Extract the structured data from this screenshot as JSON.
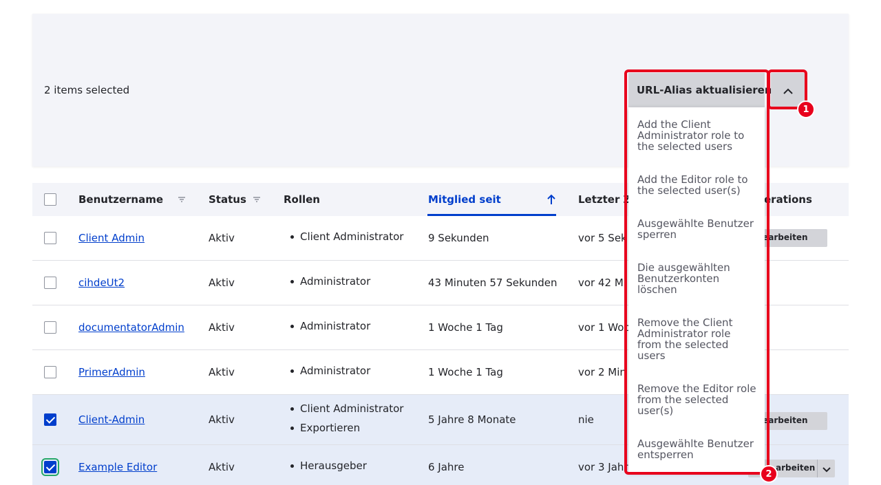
{
  "bulk": {
    "selected_count": "2 items selected",
    "action_label": "URL-Alias aktualisieren"
  },
  "table": {
    "headers": {
      "username": "Benutzername",
      "status": "Status",
      "roles": "Rollen",
      "member_since": "Mitglied seit",
      "last_access": "Letzter Z",
      "operations": "erations"
    },
    "rows": [
      {
        "username": "Client Admin",
        "status": "Aktiv",
        "roles": [
          "Client Administrator"
        ],
        "member_since": "9 Sekunden",
        "last_access": "vor 5 Sek",
        "operation": "Bearbeiten",
        "checked": false
      },
      {
        "username": "cihdeUt2",
        "status": "Aktiv",
        "roles": [
          "Administrator"
        ],
        "member_since": "43 Minuten 57 Sekunden",
        "last_access": "vor 42 Mi",
        "operation": "",
        "checked": false
      },
      {
        "username": "documentatorAdmin",
        "status": "Aktiv",
        "roles": [
          "Administrator"
        ],
        "member_since": "1 Woche 1 Tag",
        "last_access": "vor 1 Woc",
        "operation": "",
        "checked": false
      },
      {
        "username": "PrimerAdmin",
        "status": "Aktiv",
        "roles": [
          "Administrator"
        ],
        "member_since": "1 Woche 1 Tag",
        "last_access": "vor 2 Min",
        "operation": "",
        "checked": false
      },
      {
        "username": "Client-Admin",
        "status": "Aktiv",
        "roles": [
          "Client Administrator",
          "Exportieren"
        ],
        "member_since": "5 Jahre 8 Monate",
        "last_access": "nie",
        "operation": "Bearbeiten",
        "checked": true
      },
      {
        "username": "Example Editor",
        "status": "Aktiv",
        "roles": [
          "Herausgeber"
        ],
        "member_since": "6 Jahre",
        "last_access": "vor 3 Jahr",
        "operation": "arbeiten",
        "checked": true
      }
    ]
  },
  "menu": {
    "items": [
      "Add the Client Administrator role to the selected users",
      "Add the Editor role to the selected user(s)",
      "Ausgewählte Benutzer sperren",
      "Die ausgewählten Benutzerkonten löschen",
      "Remove the Client Administrator role from the selected users",
      "Remove the Editor role from the selected user(s)",
      "Ausgewählte Benutzer entsperren"
    ]
  },
  "annotations": {
    "badge_1": "1",
    "badge_2": "2"
  },
  "colors": {
    "accent": "#003ecc",
    "highlight": "#e8001c",
    "focus": "#26a769"
  }
}
